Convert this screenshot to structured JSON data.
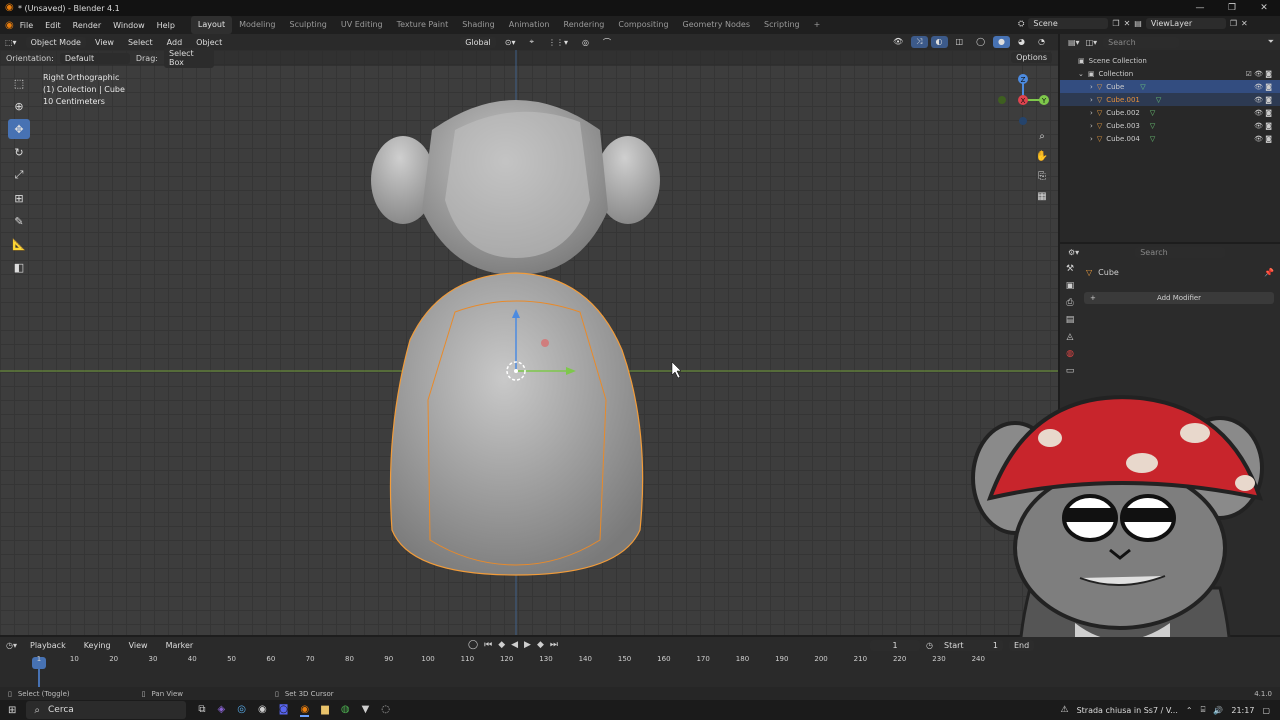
{
  "window": {
    "title": "* (Unsaved) - Blender 4.1",
    "controls": [
      "—",
      "❐",
      "✕"
    ]
  },
  "menu": [
    "File",
    "Edit",
    "Render",
    "Window",
    "Help"
  ],
  "workspaces": [
    "Layout",
    "Modeling",
    "Sculpting",
    "UV Editing",
    "Texture Paint",
    "Shading",
    "Animation",
    "Rendering",
    "Compositing",
    "Geometry Nodes",
    "Scripting"
  ],
  "active_workspace": "Layout",
  "scene": {
    "scene_name": "Scene",
    "view_layer": "ViewLayer"
  },
  "viewport_header": {
    "mode": "Object Mode",
    "view": "View",
    "select": "Select",
    "add": "Add",
    "object": "Object",
    "orientation_global": "Global"
  },
  "tool_options": {
    "orientation_label": "Orientation:",
    "orientation_value": "Default",
    "drag_label": "Drag:",
    "drag_value": "Select Box",
    "options": "Options"
  },
  "viewport_info": {
    "line1": "Right Orthographic",
    "line2": "(1) Collection | Cube",
    "line3": "10 Centimeters"
  },
  "gizmo": {
    "x": "X",
    "y": "Y",
    "z": "Z"
  },
  "outliner": {
    "search_placeholder": "Search",
    "root": "Scene Collection",
    "collection": "Collection",
    "items": [
      "Cube",
      "Cube.001",
      "Cube.002",
      "Cube.003",
      "Cube.004"
    ]
  },
  "properties": {
    "search_placeholder": "Search",
    "object_name": "Cube",
    "add_modifier": "Add Modifier"
  },
  "timeline": {
    "playback": "Playback",
    "keying": "Keying",
    "view": "View",
    "marker": "Marker",
    "current_frame": "1",
    "start_label": "Start",
    "start_value": "1",
    "end_label": "End",
    "ticks": [
      "1",
      "10",
      "20",
      "30",
      "40",
      "50",
      "60",
      "70",
      "80",
      "90",
      "100",
      "110",
      "120",
      "130",
      "140",
      "150",
      "160",
      "170",
      "180",
      "190",
      "200",
      "210",
      "220",
      "230",
      "240"
    ]
  },
  "statusbar": {
    "select": "Select (Toggle)",
    "pan": "Pan View",
    "cursor": "Set 3D Cursor",
    "version": "4.1.0"
  },
  "taskbar": {
    "search": "Cerca",
    "notification": "Strada chiusa in Ss7 / V...",
    "time": "21:17"
  }
}
